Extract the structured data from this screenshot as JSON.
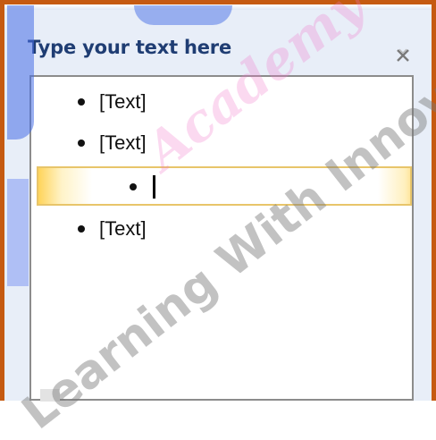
{
  "pane": {
    "title": "Type your text here",
    "close_icon": "close-icon"
  },
  "items": [
    {
      "text": "[Text]",
      "level": 1
    },
    {
      "text": "[Text]",
      "level": 1
    },
    {
      "text": "",
      "level": 2,
      "active": true
    },
    {
      "text": "[Text]",
      "level": 1
    }
  ],
  "watermark": {
    "main": "Learning With Innovation.",
    "accent": "Academy"
  },
  "colors": {
    "frame_border": "#c55a11",
    "title": "#1f3d73",
    "active_row": "#ffd45a"
  }
}
